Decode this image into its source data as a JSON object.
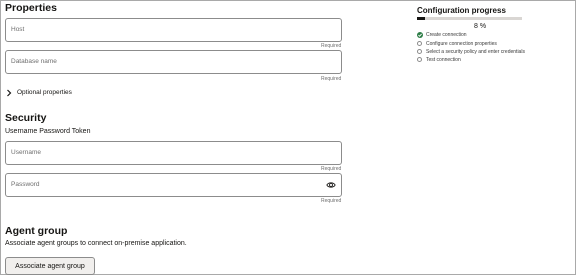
{
  "properties": {
    "title": "Properties",
    "host_placeholder": "Host",
    "host_required": "Required",
    "db_placeholder": "Database name",
    "db_required": "Required",
    "optional_label": "Optional properties"
  },
  "security": {
    "title": "Security",
    "subtitle": "Username Password Token",
    "username_placeholder": "Username",
    "username_required": "Required",
    "password_placeholder": "Password",
    "password_required": "Required"
  },
  "agent_group": {
    "title": "Agent group",
    "description": "Associate agent groups to connect on-premise application.",
    "button_label": "Associate agent group"
  },
  "configuration": {
    "title": "Configuration progress",
    "percent_text": "8 %",
    "progress_fraction": 0.08,
    "steps": [
      {
        "label": "Create connection",
        "done": true
      },
      {
        "label": "Configure connection properties",
        "done": false
      },
      {
        "label": "Select a security policy and enter credentials",
        "done": false
      },
      {
        "label": "Test connection",
        "done": false
      }
    ]
  },
  "colors": {
    "check_green": "#2d7d46",
    "progress_fill": "#161513",
    "progress_track": "#d9d6d3"
  },
  "icons": {
    "optional_toggle": "chevron-right-icon",
    "password_visibility": "eye-icon",
    "step_done": "check-circle-icon",
    "step_pending": "empty-circle-icon"
  }
}
